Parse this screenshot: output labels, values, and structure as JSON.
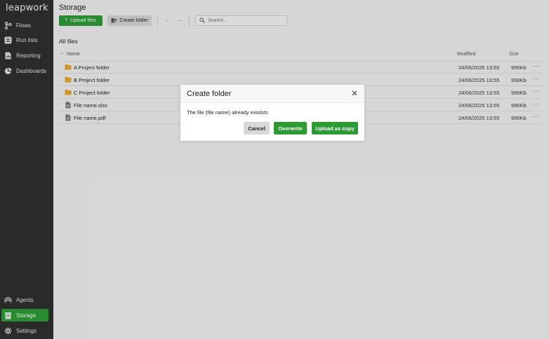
{
  "app": {
    "logo": "leapwork"
  },
  "sidebar": {
    "items": [
      {
        "label": "Flows",
        "icon": "flows-icon"
      },
      {
        "label": "Run lists",
        "icon": "run-lists-icon"
      },
      {
        "label": "Reporting",
        "icon": "reporting-icon"
      },
      {
        "label": "Dashboards",
        "icon": "dashboards-icon"
      }
    ],
    "bottom_items": [
      {
        "label": "Agents",
        "icon": "agents-icon"
      },
      {
        "label": "Storage",
        "icon": "storage-icon",
        "active": true
      },
      {
        "label": "Settings",
        "icon": "gear-icon"
      }
    ]
  },
  "toolbar": {
    "title": "Storage",
    "upload_label": "Upload files",
    "create_folder_label": "Create folder",
    "search_placeholder": "Search..."
  },
  "files": {
    "section_title": "All files",
    "columns": {
      "name": "Name",
      "modified": "Modified",
      "size": "Size"
    },
    "rows": [
      {
        "type": "folder",
        "name": "A Project folder",
        "modified": "24/06/2025 13:55",
        "size": "996Kb",
        "more": "···"
      },
      {
        "type": "folder",
        "name": "B Project folder",
        "modified": "24/06/2025 13:55",
        "size": "996Kb",
        "more": "···"
      },
      {
        "type": "folder",
        "name": "C Project folder",
        "modified": "24/06/2025 13:55",
        "size": "996Kb",
        "more": "···"
      },
      {
        "type": "file",
        "name": "File name.xlsx",
        "modified": "24/06/2025 13:55",
        "size": "996Kb",
        "more": "···"
      },
      {
        "type": "file",
        "name": "File name.pdf",
        "modified": "24/06/2025 13:55",
        "size": "996Kb",
        "more": "···"
      }
    ]
  },
  "modal": {
    "title": "Create folder",
    "message": "The file (file name) already existsts",
    "cancel_label": "Cancel",
    "overwrite_label": "Overwrite",
    "copy_label": "Upload as copy"
  },
  "colors": {
    "accent": "#2e9a36",
    "sidebar": "#2f2f2f",
    "folder": "#e8a72a"
  }
}
